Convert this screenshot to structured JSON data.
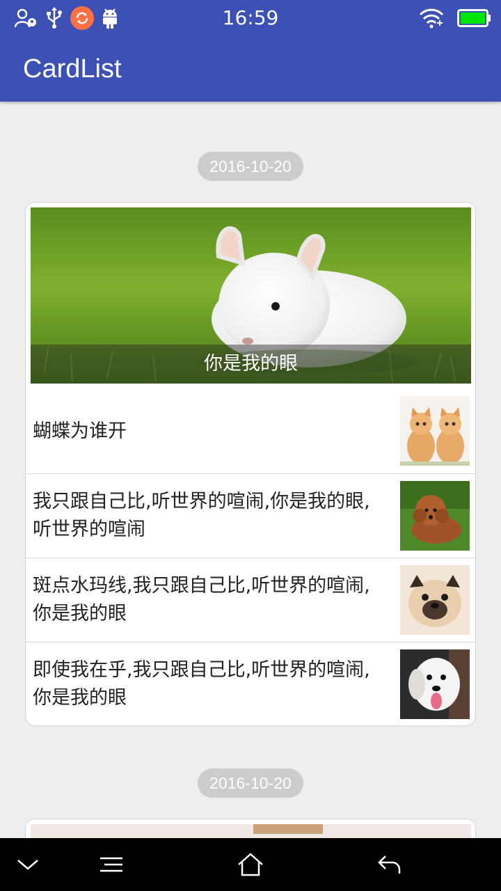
{
  "status_bar": {
    "time": "16:59",
    "icons": [
      "user-location-icon",
      "usb-icon",
      "sync-icon",
      "android-icon",
      "wifi-icon",
      "battery-icon"
    ],
    "sync_color": "#ff7043",
    "battery_color": "#00e600"
  },
  "app_bar": {
    "title": "CardList",
    "color": "#3d51b4"
  },
  "sections": [
    {
      "date": "2016-10-20",
      "hero_caption": "你是我的眼",
      "hero_image": "white-chinchilla-on-grass",
      "items": [
        {
          "text": "蝴蝶为谁开",
          "thumb": "two-kittens"
        },
        {
          "text": "我只跟自己比,听世界的喧闹,你是我的眼,听世界的喧闹",
          "thumb": "poodle-puppy"
        },
        {
          "text": "斑点水玛线,我只跟自己比,听世界的喧闹,你是我的眼",
          "thumb": "pug-dog"
        },
        {
          "text": "即使我在乎,我只跟自己比,听世界的喧闹,你是我的眼",
          "thumb": "white-dog"
        }
      ]
    },
    {
      "date": "2016-10-20"
    }
  ],
  "nav_bar": {
    "buttons": [
      "chevron-down-icon",
      "menu-icon",
      "home-icon",
      "back-icon"
    ]
  }
}
